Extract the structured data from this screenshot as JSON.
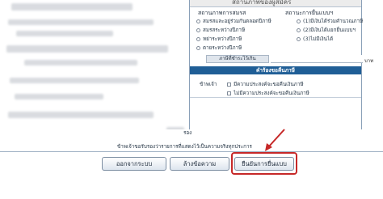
{
  "status_panel": {
    "header": "สถานภาพของผู้สมัคร",
    "marital_title": "สถานภาพการสมรส",
    "marital_options": [
      "สมรสและอยู่ร่วมกันตลอดปีภาษี",
      "สมรสระหว่างปีภาษี",
      "หย่าระหว่างปีภาษี",
      "ตายระหว่างปีภาษี"
    ],
    "income_title": "สถานะการยื่นแบบฯ",
    "income_options": [
      "(1)มีเงินได้ร่วมคำนวณภาษี",
      "(2)มีเงินได้แยกยื่นแบบฯ",
      "(3)ไม่มีเงินได้"
    ],
    "duration_label": "ภาษีที่ชำระไว้เกิน",
    "unit_suffix": "บาท"
  },
  "request_section": {
    "title": "คำร้องขอคืนภาษี",
    "requester_label": "ข้าพเจ้า",
    "options": [
      "มีความประสงค์จะขอคืนเงินภาษี",
      "ไม่มีความประสงค์จะขอคืนเงินภาษี"
    ]
  },
  "certification": {
    "label": "รอง",
    "text": "ข้าพเจ้าขอรับรองว่ารายการที่แสดงไว้เป็นความจริงทุกประการ"
  },
  "footer_buttons": {
    "exit": "ออกจากระบบ",
    "clear": "ล้างข้อความ",
    "confirm": "ยืนยันการยื่นแบบ"
  },
  "colors": {
    "accent_bar": "#1f5e96",
    "highlight": "#c62828"
  }
}
